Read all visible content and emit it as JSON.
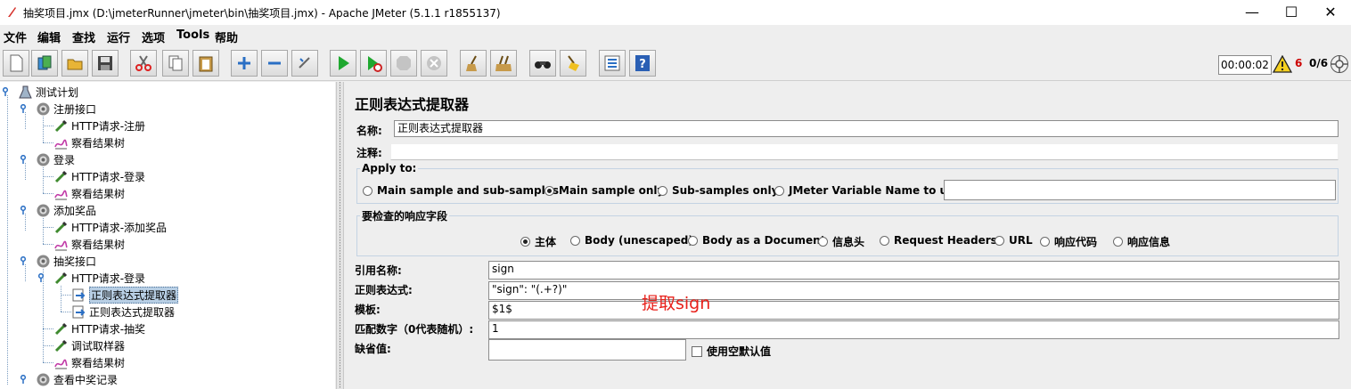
{
  "window": {
    "title": "抽奖项目.jmx (D:\\jmeterRunner\\jmeter\\bin\\抽奖项目.jmx) - Apache JMeter (5.1.1 r1855137)",
    "minimize": "—",
    "maximize": "☐",
    "close": "✕"
  },
  "menu": [
    "文件",
    "编辑",
    "查找",
    "运行",
    "选项",
    "Tools",
    "帮助"
  ],
  "toolbar": {
    "icons": [
      "new-icon",
      "templates-icon",
      "open-icon",
      "save-icon",
      "cut-icon",
      "copy-icon",
      "paste-icon",
      "expand-icon",
      "collapse-icon",
      "toggle-icon",
      "start-icon",
      "start-no-pause-icon",
      "stop-icon",
      "shutdown-icon",
      "clear-icon",
      "clear-all-icon",
      "search-icon",
      "reset-search-icon",
      "function-helper-icon",
      "help-icon"
    ],
    "timer": "00:00:02",
    "error_count": "6",
    "threads": "0/6"
  },
  "tree": {
    "nodes": [
      {
        "label": "测试计划",
        "type": "plan"
      },
      {
        "label": "注册接口",
        "type": "threadgroup"
      },
      {
        "label": "HTTP请求-注册",
        "type": "sampler"
      },
      {
        "label": "察看结果树",
        "type": "listener"
      },
      {
        "label": "登录",
        "type": "threadgroup"
      },
      {
        "label": "HTTP请求-登录",
        "type": "sampler"
      },
      {
        "label": "察看结果树",
        "type": "listener"
      },
      {
        "label": "添加奖品",
        "type": "threadgroup"
      },
      {
        "label": "HTTP请求-添加奖品",
        "type": "sampler"
      },
      {
        "label": "察看结果树",
        "type": "listener"
      },
      {
        "label": "抽奖接口",
        "type": "threadgroup"
      },
      {
        "label": "HTTP请求-登录",
        "type": "sampler"
      },
      {
        "label": "正则表达式提取器",
        "type": "extractor",
        "selected": true
      },
      {
        "label": "正则表达式提取器",
        "type": "extractor"
      },
      {
        "label": "HTTP请求-抽奖",
        "type": "sampler"
      },
      {
        "label": "调试取样器",
        "type": "sampler"
      },
      {
        "label": "察看结果树",
        "type": "listener"
      },
      {
        "label": "查看中奖记录",
        "type": "threadgroup"
      }
    ]
  },
  "panel": {
    "title": "正则表达式提取器",
    "name_label": "名称:",
    "name_value": "正则表达式提取器",
    "comment_label": "注释:",
    "comment_value": "",
    "apply_to": {
      "title": "Apply to:",
      "options": [
        "Main sample and sub-samples",
        "Main sample only",
        "Sub-samples only",
        "JMeter Variable Name to use"
      ],
      "selected": "Main sample only",
      "variable_value": ""
    },
    "field_to_check": {
      "title": "要检查的响应字段",
      "options": [
        "主体",
        "Body (unescaped)",
        "Body as a Document",
        "信息头",
        "Request Headers",
        "URL",
        "响应代码",
        "响应信息"
      ],
      "selected": "主体"
    },
    "ref_name_label": "引用名称:",
    "ref_name_value": "sign",
    "regex_label": "正则表达式:",
    "regex_value": "\"sign\": \"(.+?)\"",
    "template_label": "模板:",
    "template_value": "$1$",
    "match_no_label": "匹配数字（0代表随机）:",
    "match_no_value": "1",
    "default_label": "缺省值:",
    "default_value": "",
    "empty_default_label": "使用空默认值",
    "empty_default_checked": false
  },
  "annotation": "提取sign"
}
